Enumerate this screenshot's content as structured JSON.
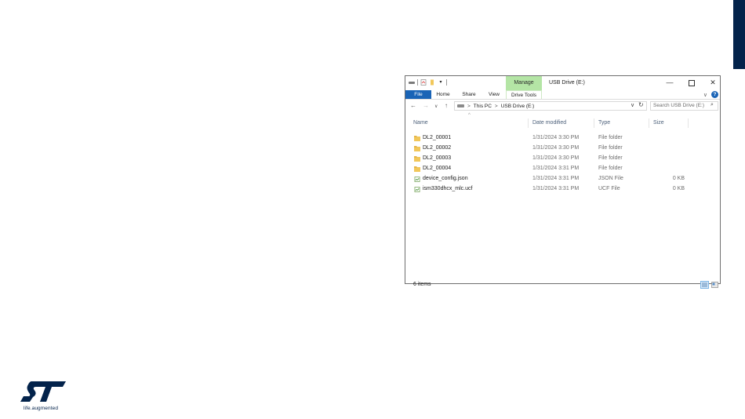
{
  "window": {
    "title": "USB Drive (E:)",
    "manage_tab": "Manage",
    "controls": {
      "minimize": "—",
      "close": "✕"
    }
  },
  "ribbon": {
    "tabs": [
      "File",
      "Home",
      "Share",
      "View",
      "Drive Tools"
    ],
    "collapse_glyph": "∨",
    "help_glyph": "?"
  },
  "nav": {
    "back": "←",
    "forward": "→",
    "recent": "∨",
    "up": "↑",
    "address": [
      "This PC",
      "USB Drive (E:)"
    ],
    "address_sep": ">",
    "dropdown": "∨",
    "refresh": "↻",
    "search_placeholder": "Search USB Drive (E:)",
    "search_glyph": "⌕"
  },
  "columns": {
    "name": "Name",
    "date": "Date modified",
    "type": "Type",
    "size": "Size",
    "sort_glyph": "^"
  },
  "files": [
    {
      "name": "DL2_00001",
      "date": "1/31/2024 3:30 PM",
      "type": "File folder",
      "size": "",
      "icon": "folder-icon"
    },
    {
      "name": "DL2_00002",
      "date": "1/31/2024 3:30 PM",
      "type": "File folder",
      "size": "",
      "icon": "folder-icon"
    },
    {
      "name": "DL2_00003",
      "date": "1/31/2024 3:30 PM",
      "type": "File folder",
      "size": "",
      "icon": "folder-icon"
    },
    {
      "name": "DL2_00004",
      "date": "1/31/2024 3:31 PM",
      "type": "File folder",
      "size": "",
      "icon": "folder-icon"
    },
    {
      "name": "device_config.json",
      "date": "1/31/2024 3:31 PM",
      "type": "JSON File",
      "size": "0 KB",
      "icon": "file-icon"
    },
    {
      "name": "ism330dhcx_mlc.ucf",
      "date": "1/31/2024 3:31 PM",
      "type": "UCF File",
      "size": "0 KB",
      "icon": "file-icon"
    }
  ],
  "status": {
    "item_count": "6 items"
  },
  "logo": {
    "tagline": "life.augmented"
  },
  "colors": {
    "accent": "#1a64b6",
    "manage": "#b4e5a5",
    "folder": "#f1c75a",
    "slide_bar": "#03234b"
  }
}
